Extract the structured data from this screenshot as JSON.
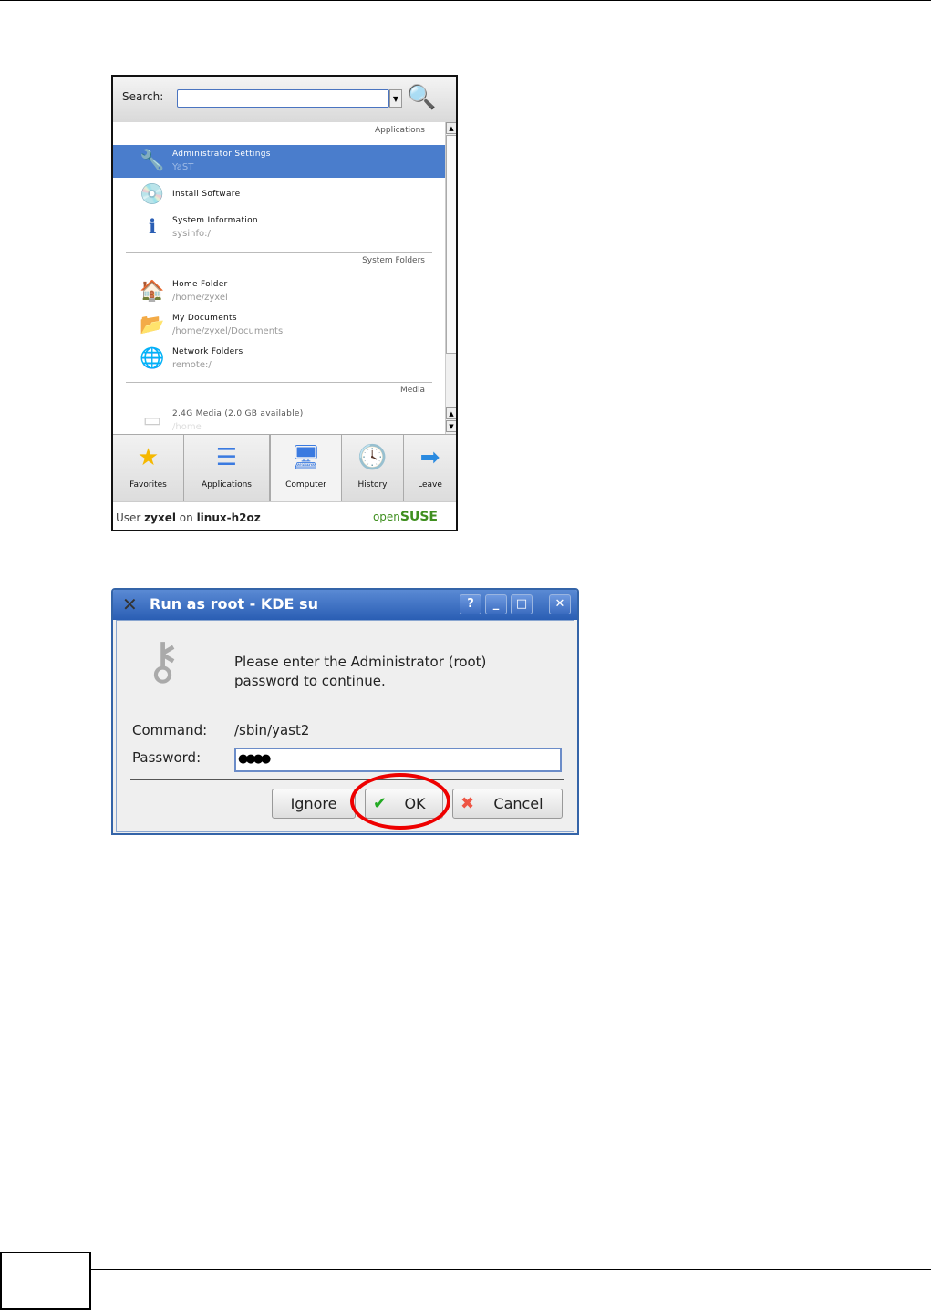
{
  "menu": {
    "search_label": "Search:",
    "sections": {
      "applications": "Applications",
      "system_folders": "System Folders",
      "media": "Media"
    },
    "items": [
      {
        "title": "Administrator Settings",
        "sub": "YaST",
        "icon": "yast-icon",
        "selected": true
      },
      {
        "title": "Install Software",
        "sub": "",
        "icon": "install-software-icon"
      },
      {
        "title": "System Information",
        "sub": "sysinfo:/",
        "icon": "info-icon"
      },
      {
        "title": "Home Folder",
        "sub": "/home/zyxel",
        "icon": "home-icon"
      },
      {
        "title": "My Documents",
        "sub": "/home/zyxel/Documents",
        "icon": "folder-icon"
      },
      {
        "title": "Network Folders",
        "sub": "remote:/",
        "icon": "globe-icon"
      },
      {
        "title": "2.4G Media (2.0 GB available)",
        "sub": "/home",
        "icon": "drive-icon"
      }
    ],
    "tabs": [
      {
        "label": "Favorites",
        "icon": "star-icon"
      },
      {
        "label": "Applications",
        "icon": "list-icon"
      },
      {
        "label": "Computer",
        "icon": "computer-icon",
        "active": true
      },
      {
        "label": "History",
        "icon": "clock-icon"
      },
      {
        "label": "Leave",
        "icon": "leave-icon"
      }
    ],
    "footer": {
      "user_prefix": "User ",
      "user": "zyxel",
      "on": " on ",
      "host": "linux-h2oz",
      "brand_open": "open",
      "brand_suse": "SUSE"
    }
  },
  "dialog": {
    "title": "Run as root - KDE su",
    "message_line1": "Please enter the Administrator (root)",
    "message_line2": "password to continue.",
    "command_label": "Command:",
    "command_value": "/sbin/yast2",
    "password_label": "Password:",
    "password_value": "●●●●",
    "buttons": {
      "ignore": "Ignore",
      "ok": "OK",
      "cancel": "Cancel"
    },
    "highlight_color": "#e00000"
  }
}
